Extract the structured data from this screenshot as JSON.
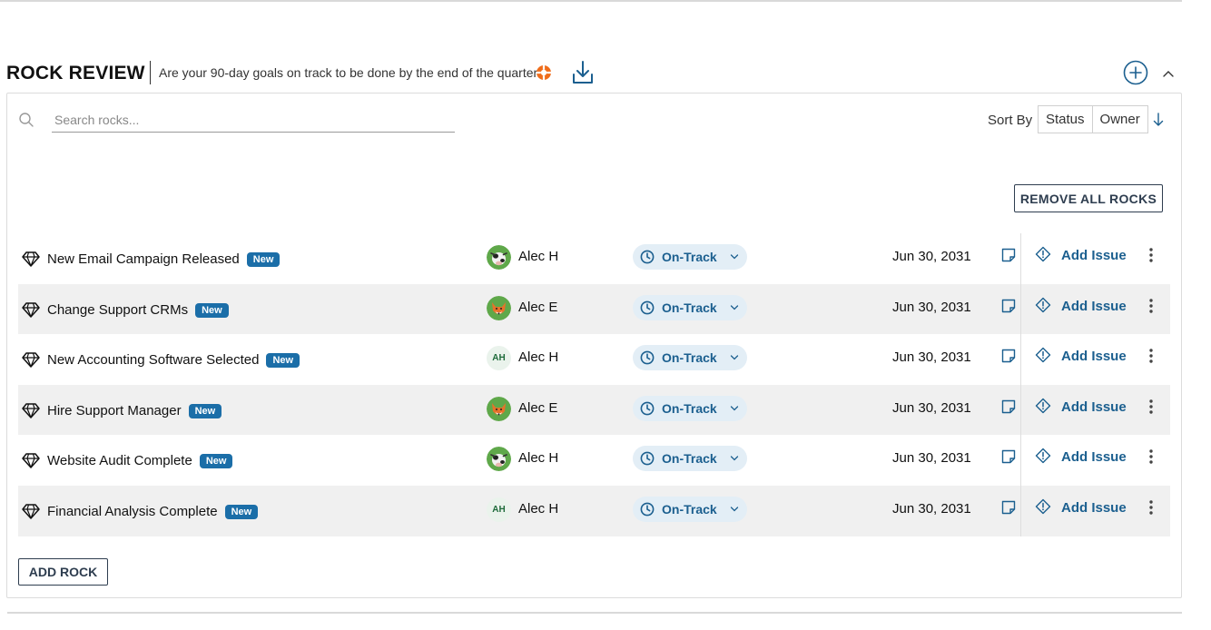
{
  "header": {
    "title": "ROCK REVIEW",
    "subtitle": "Are your 90-day goals on track to be done by the end of the quarter?",
    "icons": [
      "help-icon",
      "download-icon",
      "plus-circle-icon",
      "chevron-up-icon"
    ]
  },
  "search": {
    "placeholder": "Search rocks...",
    "value": ""
  },
  "sort": {
    "label": "Sort By",
    "options": [
      "Status",
      "Owner"
    ],
    "direction_icon": "arrow-down-icon"
  },
  "actions": {
    "remove_all_label": "REMOVE ALL ROCKS",
    "add_rock_label": "ADD ROCK"
  },
  "badge_label": "New",
  "add_issue_label": "Add Issue",
  "rocks": [
    {
      "name": "New Email Campaign Released",
      "owner": "Alec H",
      "avatar": "cow-photo",
      "status": "On-Track",
      "due": "Jun 30, 2031"
    },
    {
      "name": "Change Support CRMs",
      "owner": "Alec E",
      "avatar": "fox-photo",
      "status": "On-Track",
      "due": "Jun 30, 2031"
    },
    {
      "name": "New Accounting Software Selected",
      "owner": "Alec H",
      "avatar_initials": "AH",
      "status": "On-Track",
      "due": "Jun 30, 2031"
    },
    {
      "name": "Hire Support Manager",
      "owner": "Alec E",
      "avatar": "fox-photo",
      "status": "On-Track",
      "due": "Jun 30, 2031"
    },
    {
      "name": "Website Audit Complete",
      "owner": "Alec H",
      "avatar": "cow-photo",
      "status": "On-Track",
      "due": "Jun 30, 2031"
    },
    {
      "name": "Financial Analysis Complete",
      "owner": "Alec H",
      "avatar_initials": "AH",
      "status": "On-Track",
      "due": "Jun 30, 2031"
    }
  ],
  "colors": {
    "accent": "#1b5f8f",
    "badge": "#1b6ea8",
    "status_bg": "#e3eef6",
    "help": "#ef6c1a"
  }
}
